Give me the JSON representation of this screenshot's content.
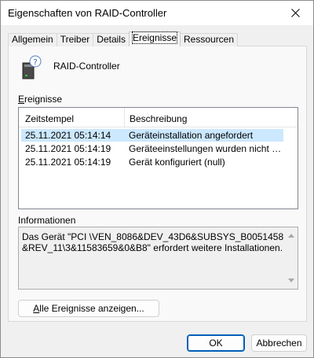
{
  "window": {
    "title": "Eigenschaften von RAID-Controller",
    "close_icon": "close-icon"
  },
  "tabs": [
    {
      "label": "Allgemein",
      "active": false
    },
    {
      "label": "Treiber",
      "active": false
    },
    {
      "label": "Details",
      "active": false
    },
    {
      "label": "Ereignisse",
      "active": true
    },
    {
      "label": "Ressourcen",
      "active": false
    }
  ],
  "device": {
    "icon": "raid-controller-device-icon",
    "name": "RAID-Controller"
  },
  "events": {
    "label_first": "E",
    "label_rest": "reignisse",
    "columns": {
      "timestamp": "Zeitstempel",
      "description": "Beschreibung"
    },
    "rows": [
      {
        "timestamp": "25.11.2021 05:14:14",
        "description": "Geräteinstallation angefordert",
        "selected": true
      },
      {
        "timestamp": "25.11.2021 05:14:19",
        "description": "Geräteeinstellungen wurden nicht migriert",
        "selected": false
      },
      {
        "timestamp": "25.11.2021 05:14:19",
        "description": "Gerät konfiguriert (null)",
        "selected": false
      }
    ]
  },
  "info": {
    "label": "Informationen",
    "text": "Das Gerät \"PCI \\VEN_8086&DEV_43D6&SUBSYS_B0051458&REV_11\\3&11583659&0&B8\" erfordert weitere Installationen."
  },
  "buttons": {
    "show_all_first": "A",
    "show_all_rest": "lle Ereignisse anzeigen...",
    "ok": "OK",
    "cancel": "Abbrechen"
  }
}
